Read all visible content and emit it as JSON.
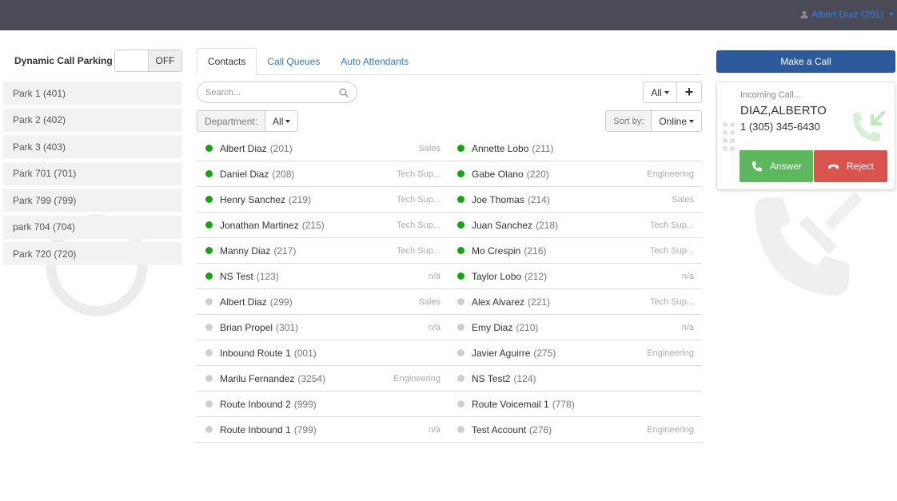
{
  "header": {
    "user_label": "Albert Diaz (201)"
  },
  "parking": {
    "title": "Dynamic Call Parking",
    "toggle_state": "OFF",
    "items": [
      {
        "label": "Park 1 (401)"
      },
      {
        "label": "Park 2 (402)"
      },
      {
        "label": "Park 3 (403)"
      },
      {
        "label": "Park 701 (701)"
      },
      {
        "label": "Park 799 (799)"
      },
      {
        "label": "park 704 (704)"
      },
      {
        "label": "Park 720 (720)"
      }
    ]
  },
  "tabs": [
    {
      "label": "Contacts",
      "active": true
    },
    {
      "label": "Call Queues",
      "active": false
    },
    {
      "label": "Auto Attendants",
      "active": false
    }
  ],
  "search": {
    "placeholder": "Search..."
  },
  "filter": {
    "all_label": "All",
    "add_label": "+",
    "department_label": "Department:",
    "department_value": "All",
    "sort_label": "Sort by:",
    "sort_value": "Online"
  },
  "contacts": [
    {
      "name": "Albert Diaz",
      "ext": "(201)",
      "dept": "Sales",
      "online": true
    },
    {
      "name": "Annette Lobo",
      "ext": "(211)",
      "dept": "",
      "online": true
    },
    {
      "name": "Daniel Diaz",
      "ext": "(208)",
      "dept": "Tech Sup...",
      "online": true
    },
    {
      "name": "Gabe Olano",
      "ext": "(220)",
      "dept": "Engineering",
      "online": true
    },
    {
      "name": "Henry Sanchez",
      "ext": "(219)",
      "dept": "Tech Sup...",
      "online": true
    },
    {
      "name": "Joe Thomas",
      "ext": "(214)",
      "dept": "Sales",
      "online": true
    },
    {
      "name": "Jonathan Martinez",
      "ext": "(215)",
      "dept": "Tech Sup...",
      "online": true
    },
    {
      "name": "Juan Sanchez",
      "ext": "(218)",
      "dept": "Tech Sup...",
      "online": true
    },
    {
      "name": "Manny Diaz",
      "ext": "(217)",
      "dept": "Tech Sup...",
      "online": true
    },
    {
      "name": "Mo Crespin",
      "ext": "(216)",
      "dept": "Tech Sup...",
      "online": true
    },
    {
      "name": "NS Test",
      "ext": "(123)",
      "dept": "n/a",
      "online": true
    },
    {
      "name": "Taylor Lobo",
      "ext": "(212)",
      "dept": "n/a",
      "online": true
    },
    {
      "name": "Albert Diaz",
      "ext": "(299)",
      "dept": "Sales",
      "online": false
    },
    {
      "name": "Alex Alvarez",
      "ext": "(221)",
      "dept": "Tech Sup...",
      "online": false
    },
    {
      "name": "Brian Propel",
      "ext": "(301)",
      "dept": "n/a",
      "online": false
    },
    {
      "name": "Emy Diaz",
      "ext": "(210)",
      "dept": "n/a",
      "online": false
    },
    {
      "name": "Inbound Route 1",
      "ext": "(001)",
      "dept": "",
      "online": false
    },
    {
      "name": "Javier Aguirre",
      "ext": "(275)",
      "dept": "Engineering",
      "online": false
    },
    {
      "name": "Marilu Fernandez",
      "ext": "(3254)",
      "dept": "Engineering",
      "online": false
    },
    {
      "name": "NS Test2",
      "ext": "(124)",
      "dept": "",
      "online": false
    },
    {
      "name": "Route Inbound 2",
      "ext": "(999)",
      "dept": "",
      "online": false
    },
    {
      "name": "Route Voicemail 1",
      "ext": "(778)",
      "dept": "",
      "online": false
    },
    {
      "name": "Route Inbound 1",
      "ext": "(799)",
      "dept": "n/a",
      "online": false
    },
    {
      "name": "Test Account",
      "ext": "(276)",
      "dept": "Engineering",
      "online": false
    }
  ],
  "call_panel": {
    "make_call_label": "Make a Call",
    "incoming_label": "Incoming Call...",
    "caller_name": "DIAZ,ALBERTO",
    "caller_number": "1 (305) 345-6430",
    "answer_label": "Answer",
    "reject_label": "Reject"
  },
  "colors": {
    "topbar": "#4a4b57",
    "link": "#337ab7",
    "online": "#17a117",
    "offline": "#cfcfcf",
    "make_call": "#2d5a9a",
    "answer": "#5cb85c",
    "reject": "#d9534f"
  }
}
